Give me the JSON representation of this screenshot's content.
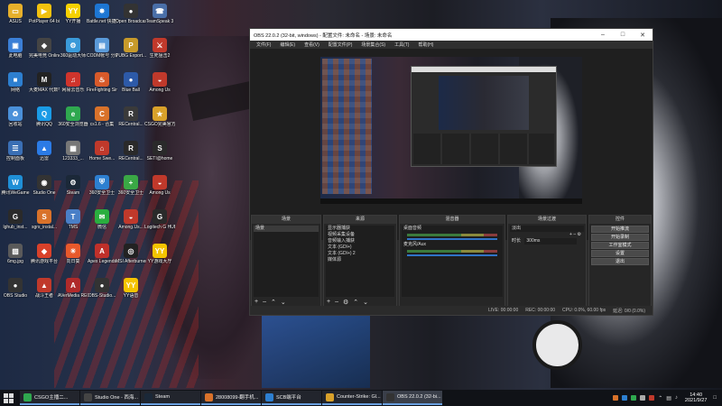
{
  "desktop_icons": [
    {
      "label": "ASUS",
      "color": "#e6b02b",
      "glyph": "▭"
    },
    {
      "label": "PotPlayer 64 bit",
      "color": "#f2c10e",
      "glyph": "▶"
    },
    {
      "label": "YY开播",
      "color": "#f5d100",
      "glyph": "YY"
    },
    {
      "label": "Battle.net 快捷方式",
      "color": "#1d76d3",
      "glyph": "✵"
    },
    {
      "label": "Open Broadcast...",
      "color": "#333333",
      "glyph": "●"
    },
    {
      "label": "TeamSpeak 3",
      "color": "#4a6fa8",
      "glyph": "☎"
    },
    {
      "label": "此电脑",
      "color": "#3b7fd6",
      "glyph": "▣"
    },
    {
      "label": "完美电竞 Online",
      "color": "#444444",
      "glyph": "◆"
    },
    {
      "label": "360驱动大师",
      "color": "#3a9ad9",
      "glyph": "⚙"
    },
    {
      "label": "CODM帐号 分配alse",
      "color": "#5a9ad9",
      "glyph": "▤"
    },
    {
      "label": "PUBG Export...",
      "color": "#c79a2a",
      "glyph": "P"
    },
    {
      "label": "生死狙击2",
      "color": "#c0392b",
      "glyph": "⚔"
    },
    {
      "label": "网络",
      "color": "#2d7fd0",
      "glyph": "■"
    },
    {
      "label": "大麦MAX 代数学",
      "color": "#222222",
      "glyph": "M"
    },
    {
      "label": "网易云音乐",
      "color": "#d0342c",
      "glyph": "♫"
    },
    {
      "label": "FireFighting Simulator...",
      "color": "#d85a2a",
      "glyph": "♨"
    },
    {
      "label": "Blue Ball",
      "color": "#2d5aa8",
      "glyph": "●"
    },
    {
      "label": "Among Us",
      "color": "#c0392b",
      "glyph": "◒"
    },
    {
      "label": "回收站",
      "color": "#4a90d9",
      "glyph": "♻"
    },
    {
      "label": "腾讯QQ",
      "color": "#1a9be6",
      "glyph": "Q"
    },
    {
      "label": "360安全浏览器",
      "color": "#2fa84f",
      "glyph": "e"
    },
    {
      "label": "cs1.6 - 合集",
      "color": "#d9722a",
      "glyph": "C"
    },
    {
      "label": "RECentral...",
      "color": "#3a3a3a",
      "glyph": "R"
    },
    {
      "label": "CSGO完美官方客户端",
      "color": "#d9a12a",
      "glyph": "★"
    },
    {
      "label": "控制面板",
      "color": "#3a6fb5",
      "glyph": "☰"
    },
    {
      "label": "迅雷",
      "color": "#2b7be6",
      "glyph": "▲"
    },
    {
      "label": "123333_...",
      "color": "#777777",
      "glyph": "▦"
    },
    {
      "label": "Home Swe...",
      "color": "#c0392b",
      "glyph": "⌂"
    },
    {
      "label": "RECentral...",
      "color": "#2a2a2a",
      "glyph": "R"
    },
    {
      "label": "SETI@home",
      "color": "#2a2a2a",
      "glyph": "S"
    },
    {
      "label": "腾讯WeGame",
      "color": "#1f8fd6",
      "glyph": "W"
    },
    {
      "label": "Studio One",
      "color": "#333333",
      "glyph": "◉"
    },
    {
      "label": "Steam",
      "color": "#1b2838",
      "glyph": "⚙"
    },
    {
      "label": "360安全卫士",
      "color": "#2d7fd0",
      "glyph": "⛨"
    },
    {
      "label": "360安全卫士",
      "color": "#3aa845",
      "glyph": "+"
    },
    {
      "label": "Among Us",
      "color": "#c0392b",
      "glyph": "◒"
    },
    {
      "label": "lghub_inst...",
      "color": "#2a2a2a",
      "glyph": "G"
    },
    {
      "label": "sgrs_instal...",
      "color": "#d9722a",
      "glyph": "S"
    },
    {
      "label": "TMS",
      "color": "#4a7fc7",
      "glyph": "T"
    },
    {
      "label": "微信",
      "color": "#2aae3f",
      "glyph": "✉"
    },
    {
      "label": "Among.Us...",
      "color": "#c0392b",
      "glyph": "◒"
    },
    {
      "label": "Logitech G HUB",
      "color": "#2a2a2a",
      "glyph": "G"
    },
    {
      "label": "6mg.jpg",
      "color": "#5a5a5a",
      "glyph": "▧"
    },
    {
      "label": "腾讯游戏平台",
      "color": "#d9412a",
      "glyph": "◆"
    },
    {
      "label": "向日葵",
      "color": "#e8592b",
      "glyph": "☀"
    },
    {
      "label": "Apex Legends",
      "color": "#c0302a",
      "glyph": "A"
    },
    {
      "label": "MSI Afterburner",
      "color": "#222222",
      "glyph": "◎"
    },
    {
      "label": "YY游戏大厅",
      "color": "#f5c400",
      "glyph": "YY"
    },
    {
      "label": "OBS Studio",
      "color": "#333333",
      "glyph": "●"
    },
    {
      "label": "战斗王者",
      "color": "#c0392b",
      "glyph": "▲"
    },
    {
      "label": "AVerMedia RECentral 4",
      "color": "#b02a2a",
      "glyph": "A"
    },
    {
      "label": "OBS-Studio...",
      "color": "#333333",
      "glyph": "●"
    },
    {
      "label": "YY语音",
      "color": "#f5c400",
      "glyph": "YY"
    }
  ],
  "obs": {
    "title": "OBS 22.0.2 (32-bit, windows) - 配置文件: 未命名 - 场景: 未命名",
    "menu": [
      "文件(F)",
      "编辑(E)",
      "查看(V)",
      "配置文件(P)",
      "场景集合(S)",
      "工具(T)",
      "帮助(H)"
    ],
    "docks": {
      "scenes": {
        "title": "场景",
        "items": [
          "场景"
        ]
      },
      "sources": {
        "title": "来源",
        "items": [
          "显示器捕获",
          "视频采集设备",
          "音频输入捕获",
          "文本 (GDI+)",
          "文本 (GDI+) 2",
          "媒体源"
        ]
      },
      "mixer": {
        "title": "混音器",
        "tracks": [
          "桌面音频",
          "麦克风/Aux"
        ]
      },
      "transitions": {
        "title": "场景过渡",
        "type": "淡出",
        "duration_label": "时长",
        "duration": "300ms"
      },
      "controls": {
        "title": "控件",
        "buttons": [
          "开始推流",
          "开始录制",
          "工作室模式",
          "设置",
          "退出"
        ]
      }
    },
    "status": {
      "live": "LIVE: 00:00:00",
      "rec": "REC: 00:00:00",
      "cpu": "CPU: 0.0%, 60.00 fps",
      "fps": "延迟: 0/0 (0.0%)"
    }
  },
  "taskbar": {
    "tasks": [
      {
        "label": "CSGO主播二...",
        "color": "#2fa84f"
      },
      {
        "label": "Studio One - 西海...",
        "color": "#444444"
      },
      {
        "label": "Steam",
        "color": "#1b2838"
      },
      {
        "label": "28008099-翻手机...",
        "color": "#d9722a"
      },
      {
        "label": "SCB端平台",
        "color": "#2d7fd0"
      },
      {
        "label": "Counter-Strike: Gl...",
        "color": "#d9a12a"
      },
      {
        "label": "OBS 22.0.2 (32-bi...",
        "color": "#333333"
      }
    ],
    "time": "14:40",
    "date": "2021/9/27"
  }
}
